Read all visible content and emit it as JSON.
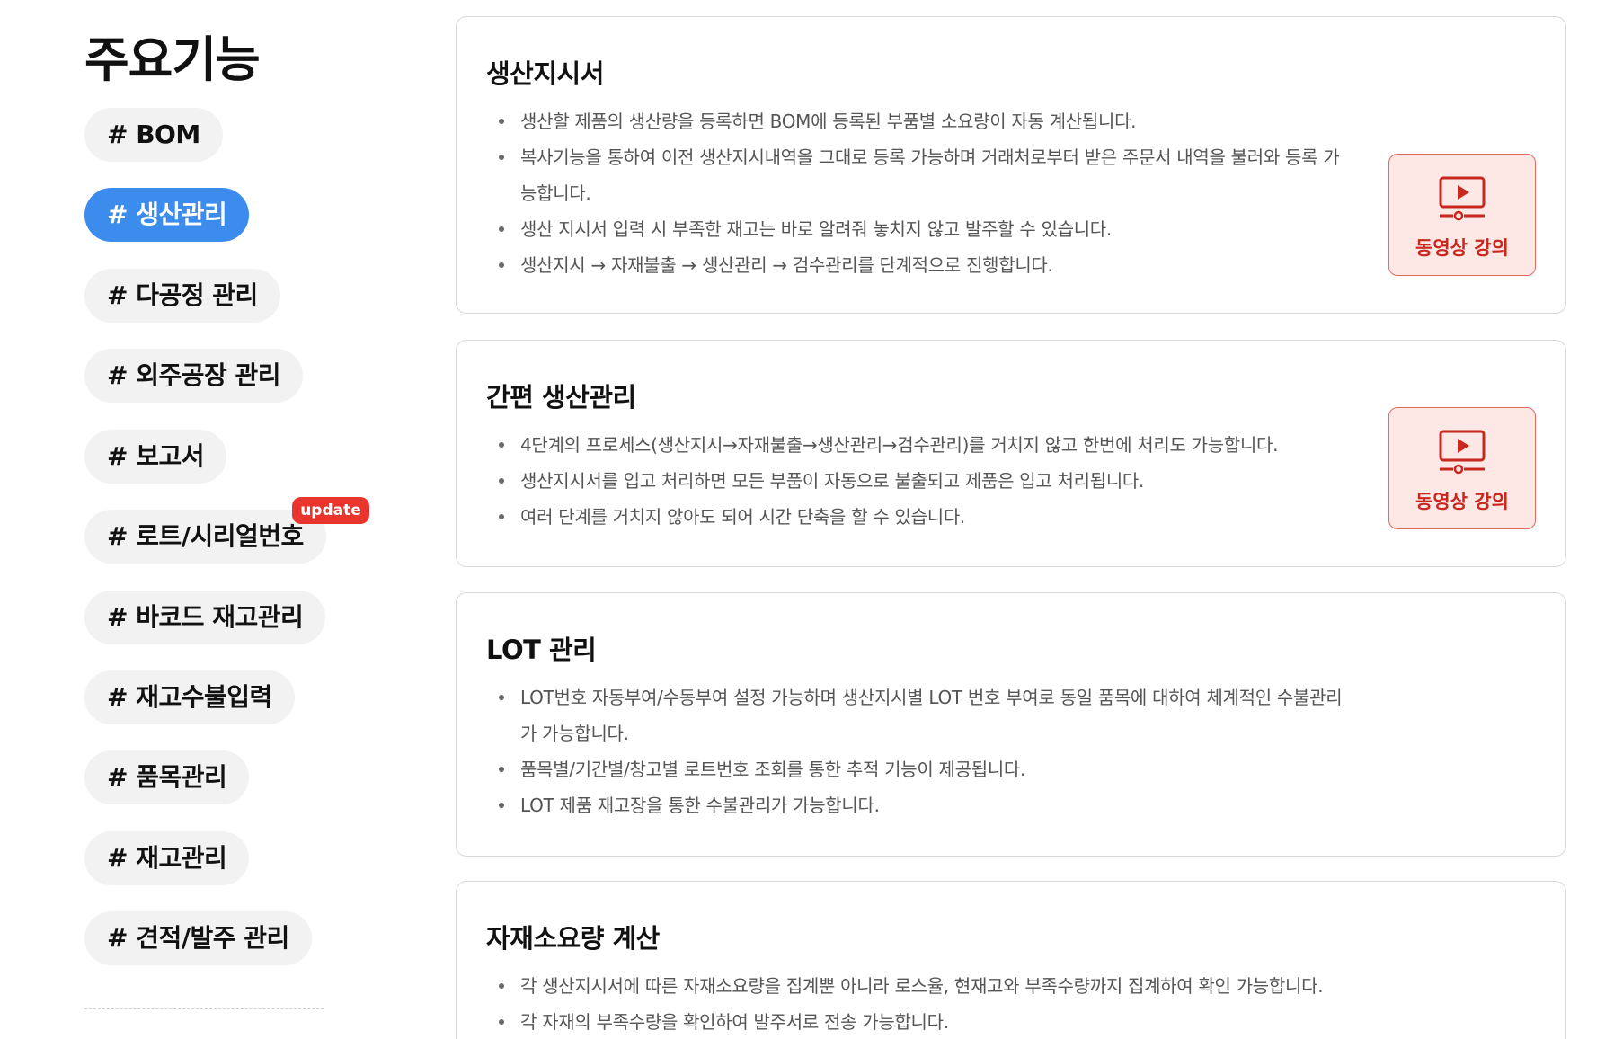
{
  "sidebar": {
    "title": "주요기능",
    "tags": [
      {
        "label": "# BOM"
      },
      {
        "label": "# 생산관리"
      },
      {
        "label": "# 다공정 관리"
      },
      {
        "label": "# 외주공장 관리"
      },
      {
        "label": "# 보고서"
      },
      {
        "label": "# 로트/시리얼번호",
        "badge": "update"
      },
      {
        "label": "# 바코드 재고관리"
      },
      {
        "label": "# 재고수불입력"
      },
      {
        "label": "# 품목관리"
      },
      {
        "label": "# 재고관리"
      },
      {
        "label": "# 견적/발주 관리"
      }
    ],
    "active_tag": "# 생산관리"
  },
  "cards": [
    {
      "title": "생산지시서",
      "items": [
        "생산할 제품의 생산량을 등록하면 BOM에 등록된 부품별 소요량이 자동 계산됩니다.",
        "복사기능을 통하여 이전 생산지시내역을 그대로 등록 가능하며 거래처로부터 받은 주문서 내역을 불러와 등록 가능합니다.",
        "생산 지시서 입력 시 부족한 재고는 바로 알려줘 놓치지 않고 발주할 수 있습니다.",
        "생산지시 → 자재불출 → 생산관리 → 검수관리를 단계적으로 진행합니다."
      ],
      "video_label": "동영상 강의"
    },
    {
      "title": "간편 생산관리",
      "items": [
        "4단계의 프로세스(생산지시→자재불출→생산관리→검수관리)를 거치지 않고 한번에 처리도 가능합니다.",
        "생산지시서를 입고 처리하면 모든 부품이 자동으로 불출되고 제품은 입고 처리됩니다.",
        "여러 단계를 거치지 않아도 되어 시간 단축을 할 수 있습니다."
      ],
      "video_label": "동영상 강의"
    },
    {
      "title": "LOT 관리",
      "items": [
        "LOT번호 자동부여/수동부여 설정 가능하며 생산지시별 LOT 번호 부여로 동일 품목에 대하여 체계적인 수불관리가 가능합니다.",
        "품목별/기간별/창고별 로트번호 조회를 통한 추적 기능이 제공됩니다.",
        "LOT 제품 재고장을 통한 수불관리가 가능합니다."
      ]
    },
    {
      "title": "자재소요량 계산",
      "items": [
        "각 생산지시서에 따른 자재소요량을 집계뿐 아니라 로스율, 현재고와 부족수량까지 집계하여 확인 가능합니다.",
        "각 자재의 부족수량을 확인하여 발주서로 전송 가능합니다."
      ]
    }
  ],
  "colors": {
    "active_tag_bg": "#3b8ced",
    "badge_bg": "#e8362e",
    "video_btn_bg": "#fde8e6",
    "video_btn_text": "#c8281e"
  },
  "icons": {
    "video": "video-play-icon"
  }
}
